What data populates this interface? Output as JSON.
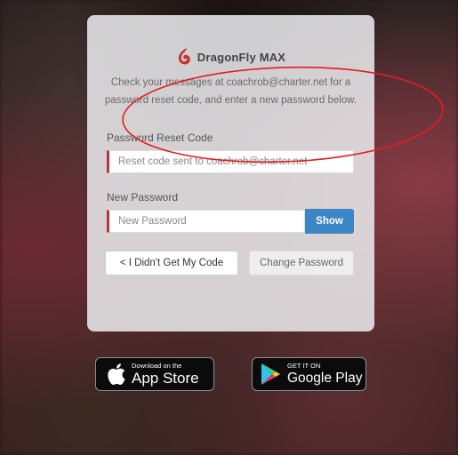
{
  "brand": {
    "name": "DragonFly MAX",
    "accent": "#c8302f"
  },
  "message": "Check your messages at coachrob@charter.net for a password reset code, and enter a new password below.",
  "reset_code": {
    "label": "Password Reset Code",
    "value": "",
    "placeholder": "Reset code sent to coachrob@charter.net"
  },
  "new_password": {
    "label": "New Password",
    "value": "",
    "placeholder": "New Password",
    "show_label": "Show"
  },
  "actions": {
    "no_code_label": "< I Didn't Get My Code",
    "change_label": "Change Password"
  },
  "app_store": {
    "small": "Download on the",
    "big": "App Store"
  },
  "google_play": {
    "small": "GET IT ON",
    "big": "Google Play"
  },
  "colors": {
    "input_accent": "#b8333a",
    "show_button": "#3d86c6",
    "annotation": "#e41e1e"
  }
}
